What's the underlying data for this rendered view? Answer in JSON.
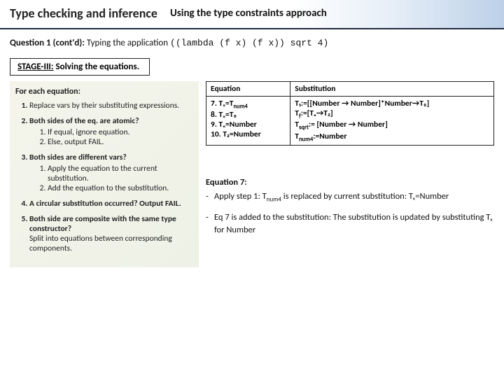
{
  "header": {
    "title_main": "Type checking and inference",
    "title_sub": "Using the type constraints approach"
  },
  "question": {
    "label": "Question 1 (cont'd):",
    "prefix": "  Typing the application ",
    "code": "((lambda (f x) (f x)) sqrt 4)"
  },
  "stage": {
    "label_u": "STAGE-III:",
    "label_rest": " Solving the equations."
  },
  "algo": {
    "heading": "For each equation:",
    "s1": "Replace vars by their substituting expressions.",
    "s2": "Both sides of the eq. are atomic?",
    "s2a": "If equal, ignore equation.",
    "s2b": "Else, output FAIL.",
    "s3": "Both sides are different vars?",
    "s3a": "Apply the equation to the current substitution.",
    "s3b": "Add the equation to the substitution.",
    "s4": "A circular substitution occurred? Output FAIL.",
    "s5": "Both side are composite with the same type constructor?",
    "s5n": "Split into equations between corresponding components."
  },
  "table": {
    "h1": "Equation",
    "h2": "Substitution",
    "eq7": "7. Tₓ=T",
    "eq7s": "num4",
    "eq8": "8. Tₓ=T₀",
    "eq9": "9. Tₓ=Number",
    "eq10": "10. T₂=Number",
    "sub1a": "T₁:=[[Number → Number]*Number→T₀]",
    "sub2a": "T",
    "sub2b": ":=[Tₓ→T₂]",
    "sub3a": "T",
    "sub3s": "sqrt",
    "sub3b": ":= [Number → Number]",
    "sub4a": "T",
    "sub4s": "num4",
    "sub4b": ":=Number",
    "subf": "f"
  },
  "explain": {
    "hd": "Equation 7:",
    "l1a": "Apply step 1: T",
    "l1s": "num4",
    "l1b": " is replaced by current substitution: Tₓ=Number",
    "l2": "Eq 7 is added to the substitution: The substitution is updated by substituting Tₓ for Number"
  }
}
